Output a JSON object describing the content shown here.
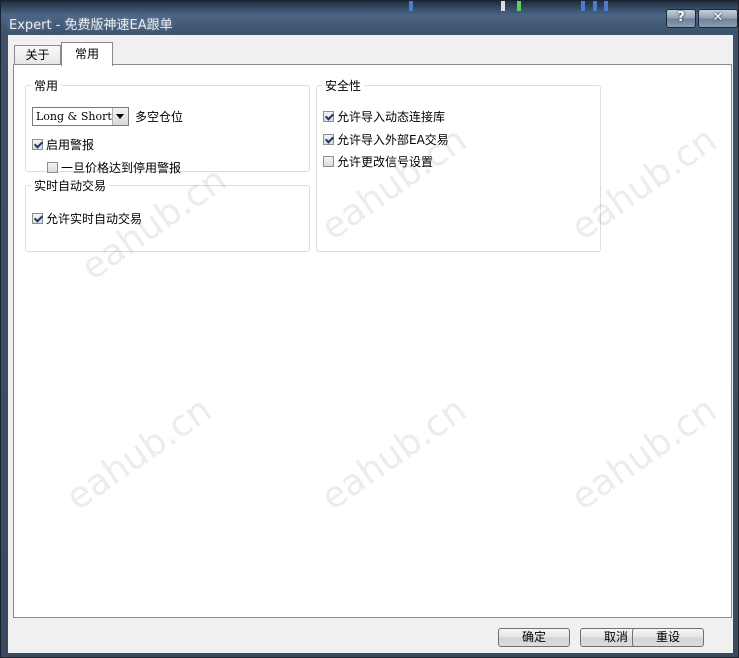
{
  "window": {
    "title": "Expert - 免费版神速EA跟单",
    "help_label": "?",
    "close_label": "✕"
  },
  "tabs": [
    {
      "label": "关于",
      "active": false
    },
    {
      "label": "常用",
      "active": true
    }
  ],
  "general_group": {
    "title": "常用",
    "position_select": {
      "value": "Long & Short",
      "label": "多空仓位"
    },
    "enable_alerts": {
      "label": "启用警报",
      "checked": true
    },
    "stop_alert_on_price": {
      "label": "一旦价格达到停用警报",
      "checked": false
    }
  },
  "autotrade_group": {
    "title": "实时自动交易",
    "allow_live_trading": {
      "label": "允许实时自动交易",
      "checked": true
    }
  },
  "security_group": {
    "title": "安全性",
    "allow_dll_imports": {
      "label": "允许导入动态连接库",
      "checked": true
    },
    "allow_external_ea_imports": {
      "label": "允许导入外部EA交易",
      "checked": true
    },
    "allow_signal_changes": {
      "label": "允许更改信号设置",
      "checked": false
    }
  },
  "buttons": {
    "ok": "确定",
    "cancel": "取消",
    "reset": "重设"
  },
  "watermark": "eahub.cn"
}
